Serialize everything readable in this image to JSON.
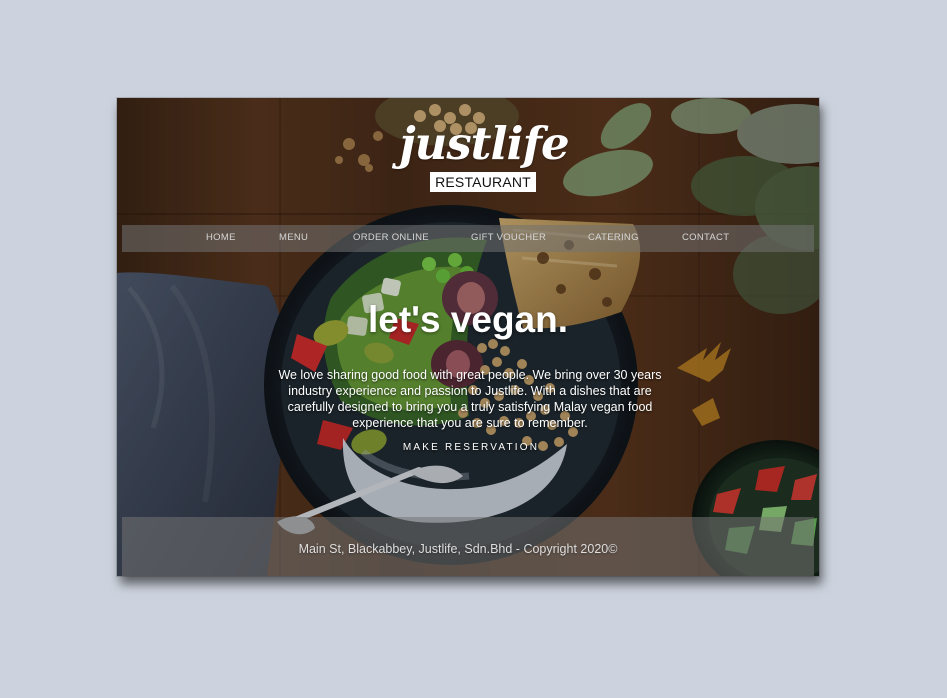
{
  "brand": {
    "name": "justlife",
    "subtitle": "RESTAURANT"
  },
  "nav": {
    "items": [
      {
        "label": "HOME"
      },
      {
        "label": "MENU"
      },
      {
        "label": "ORDER ONLINE"
      },
      {
        "label": "GIFT VOUCHER"
      },
      {
        "label": "CATERING"
      },
      {
        "label": "CONTACT"
      }
    ]
  },
  "hero": {
    "title": "let's vegan.",
    "description": "We love sharing good food with great people. We bring over 30 years industry experience and passion to Justlife. With a dishes that are carefully designed to bring you a truly satisfying Malay vegan food experience that you are sure to remember.",
    "cta": "MAKE RESERVATION",
    "background_image": "vegan-bowl-photo"
  },
  "footer": {
    "text": "Main St, Blackabbey, Justlife, Sdn.Bhd - Copyright 2020©"
  },
  "colors": {
    "page_background": "#cdd3de",
    "overlay_bar": "#737373",
    "text_primary": "#ffffff"
  }
}
